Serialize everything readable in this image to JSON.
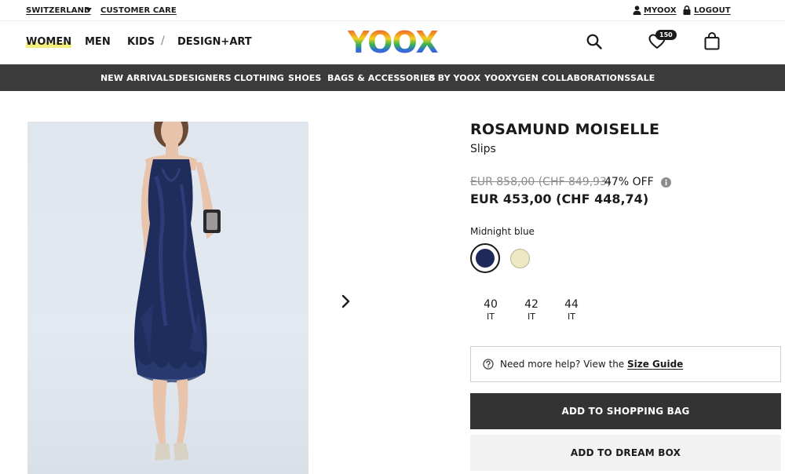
{
  "topbar": {
    "country": "SWITZERLAND",
    "customer_care": "CUSTOMER CARE",
    "account": "MYOOX",
    "logout": "LOGOUT"
  },
  "header": {
    "nav": [
      "WOMEN",
      "MEN",
      "KIDS",
      "DESIGN+ART"
    ],
    "logo": "YOOX",
    "wishlist_count": "150"
  },
  "categories": [
    "NEW ARRIVALS",
    "DESIGNERS",
    "CLOTHING",
    "SHOES",
    "BAGS & ACCESSORIES",
    "8 BY YOOX",
    "YOOXYGEN",
    "COLLABORATIONS",
    "SALE"
  ],
  "product": {
    "brand": "ROSAMUND MOISELLE",
    "category": "Slips",
    "old_price": "EUR 858,00 (CHF 849,93)",
    "discount": "47% OFF",
    "price": "EUR 453,00 (CHF 448,74)",
    "color_name": "Midnight blue",
    "colors": [
      "#1f2a5a",
      "#ece9c4"
    ],
    "sizes": [
      {
        "size": "40",
        "unit": "IT"
      },
      {
        "size": "42",
        "unit": "IT"
      },
      {
        "size": "44",
        "unit": "IT"
      }
    ],
    "help_text": "Need more help? View the ",
    "help_link": "Size Guide",
    "add_to_bag": "ADD TO SHOPPING BAG",
    "add_to_dream_box": "ADD TO DREAM BOX"
  },
  "icons": {
    "dropdown": "chevron-down-icon",
    "user": "user-icon",
    "lock": "lock-icon",
    "search": "search-icon",
    "wishlist": "heart-icon",
    "bag": "shopping-bag-icon",
    "next": "chevron-right-icon",
    "info": "info-icon",
    "help": "question-icon"
  }
}
